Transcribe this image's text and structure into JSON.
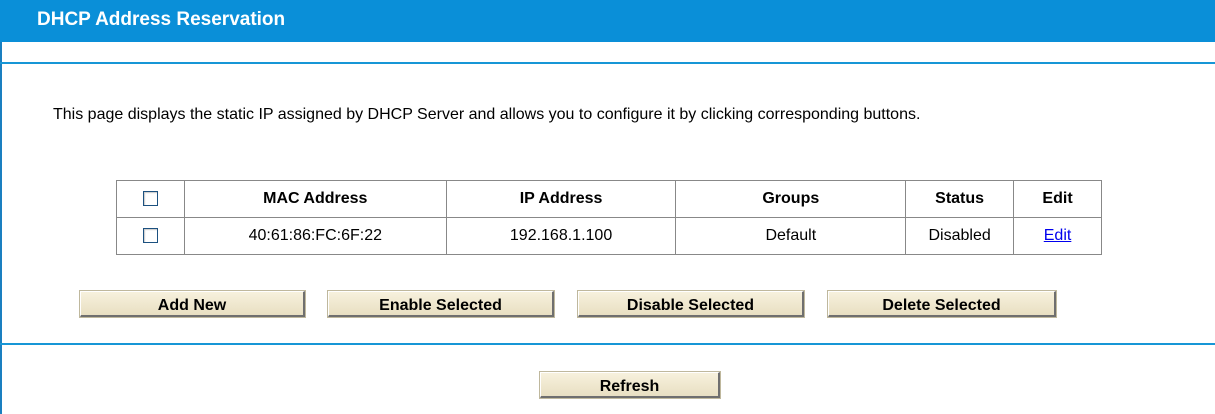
{
  "header": {
    "title": "DHCP Address Reservation"
  },
  "description": "This page displays the static IP assigned by DHCP Server and allows you to configure it by clicking corresponding buttons.",
  "table": {
    "columns": [
      "MAC Address",
      "IP Address",
      "Groups",
      "Status",
      "Edit"
    ],
    "rows": [
      {
        "mac": "40:61:86:FC:6F:22",
        "ip": "192.168.1.100",
        "group": "Default",
        "status": "Disabled",
        "edit": "Edit"
      }
    ]
  },
  "buttons": {
    "add_new": "Add New",
    "enable_selected": "Enable Selected",
    "disable_selected": "Disable Selected",
    "delete_selected": "Delete Selected",
    "refresh": "Refresh"
  },
  "colors": {
    "header_bg": "#0a8fd8",
    "divider": "#1796d6",
    "link": "#0000ee"
  }
}
